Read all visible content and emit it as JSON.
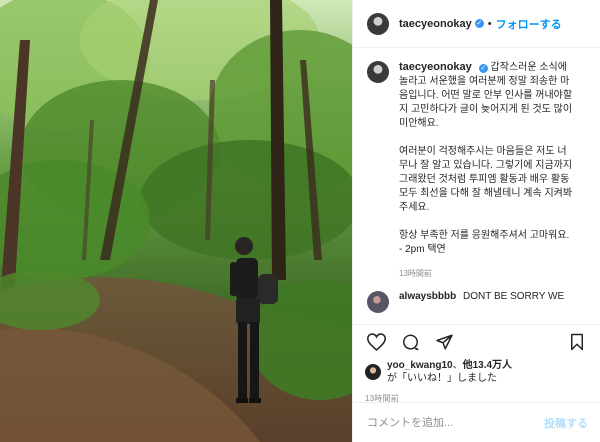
{
  "post": {
    "username": "taecyeonokay",
    "follow_label": "フォローする",
    "caption_paragraphs": [
      "갑작스러운 소식에 놀라고 서운했을 여러분께 정말 죄송한 마음입니다. 어떤 말로 안부 인사를 꺼내야할지 고민하다가 글이 늦어지게 된 것도 많이 미안해요.",
      "여러분이 걱정해주시는 마음들은 저도 너무나 잘 알고 있습니다. 그렇기에 지금까지 그래왔던 것처럼 투피엠 활동과 배우 활동 모두 최선을 다해 잘 해낼테니 계속 지켜봐주세요.",
      "항상 부족한 저를 응원해주셔서 고마워요.\n- 2pm 택연"
    ],
    "caption_time": "13時間前",
    "next_comment_user": "alwaysbbbb",
    "next_comment_text": "DONT BE SORRY WE"
  },
  "likes": {
    "liker": "yoo_kwang10",
    "others": "他13.4万人",
    "suffix": "が「いいね！」しました"
  },
  "time": "13時間前",
  "add_comment": {
    "placeholder": "コメントを追加...",
    "post_label": "投稿する"
  },
  "icons": [
    "heart-icon",
    "comment-icon",
    "share-icon",
    "bookmark-icon"
  ],
  "colors": {
    "link_blue": "#0095f6",
    "muted": "#8e8e8e",
    "post_disabled": "#b2dffc"
  }
}
